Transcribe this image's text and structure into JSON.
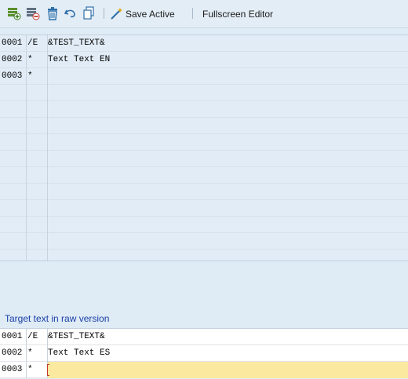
{
  "toolbar": {
    "icons": [
      "insert-line-icon",
      "delete-line-icon",
      "trash-icon",
      "undo-icon",
      "copy-icon",
      "magic-wand-icon"
    ],
    "save_active_label": "Save Active",
    "fullscreen_label": "Fullscreen Editor"
  },
  "source_editor": {
    "rows": [
      {
        "num": "0001",
        "fmt": "/E",
        "text": "&TEST_TEXT&"
      },
      {
        "num": "0002",
        "fmt": "*",
        "text": "Text Text EN"
      },
      {
        "num": "0003",
        "fmt": "*",
        "text": ""
      }
    ]
  },
  "target_editor": {
    "title": "Target text in raw version",
    "rows": [
      {
        "num": "0001",
        "fmt": "/E",
        "text": "&TEST_TEXT&"
      },
      {
        "num": "0002",
        "fmt": "*",
        "text": "Text Text ES"
      },
      {
        "num": "0003",
        "fmt": "*",
        "text": ""
      }
    ]
  }
}
